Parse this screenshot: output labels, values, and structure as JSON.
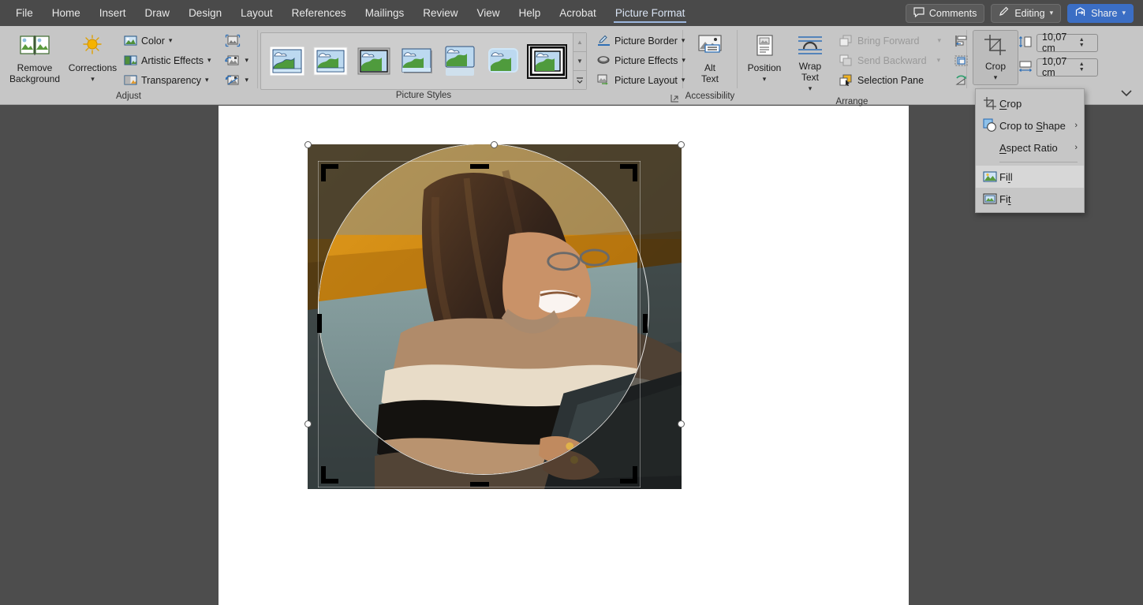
{
  "titlebar": {
    "menu": [
      {
        "label": "File",
        "active": false
      },
      {
        "label": "Home",
        "active": false
      },
      {
        "label": "Insert",
        "active": false
      },
      {
        "label": "Draw",
        "active": false
      },
      {
        "label": "Design",
        "active": false
      },
      {
        "label": "Layout",
        "active": false
      },
      {
        "label": "References",
        "active": false
      },
      {
        "label": "Mailings",
        "active": false
      },
      {
        "label": "Review",
        "active": false
      },
      {
        "label": "View",
        "active": false
      },
      {
        "label": "Help",
        "active": false
      },
      {
        "label": "Acrobat",
        "active": false
      },
      {
        "label": "Picture Format",
        "active": true
      }
    ],
    "comments_label": "Comments",
    "editing_label": "Editing",
    "share_label": "Share",
    "share_color": "#3b6ec4"
  },
  "ribbon": {
    "adjust": {
      "group_label": "Adjust",
      "remove_background": "Remove\nBackground",
      "remove_background_line1": "Remove",
      "remove_background_line2": "Background",
      "corrections": "Corrections",
      "color": "Color",
      "artistic_effects": "Artistic Effects",
      "transparency": "Transparency",
      "compress_icon": "compress-pictures-icon",
      "change_icon": "change-picture-icon",
      "reset_icon": "reset-picture-icon"
    },
    "picture_styles": {
      "group_label": "Picture Styles",
      "thumbnails": [
        {
          "name": "simple-frame-white",
          "selected": false
        },
        {
          "name": "beveled-matte-white",
          "selected": false
        },
        {
          "name": "metal-frame",
          "selected": false
        },
        {
          "name": "drop-shadow-rectangle",
          "selected": false
        },
        {
          "name": "reflected-rounded-rectangle",
          "selected": false
        },
        {
          "name": "soft-edge-rectangle",
          "selected": false
        },
        {
          "name": "double-frame-black",
          "selected": true
        }
      ],
      "scroll_up": "▲",
      "scroll_down": "▼",
      "more": "▼"
    },
    "picture_tools": {
      "picture_border": "Picture Border",
      "picture_effects": "Picture Effects",
      "picture_layout": "Picture Layout"
    },
    "accessibility": {
      "group_label": "Accessibility",
      "alt_text_line1": "Alt",
      "alt_text_line2": "Text"
    },
    "arrange": {
      "group_label": "Arrange",
      "position": "Position",
      "wrap_text_line1": "Wrap",
      "wrap_text_line2": "Text",
      "bring_forward": "Bring Forward",
      "send_backward": "Send Backward",
      "selection_pane": "Selection Pane",
      "align_icon": "align-objects-icon",
      "group_icon": "group-objects-icon",
      "rotate_icon": "rotate-objects-icon"
    },
    "size": {
      "crop_label": "Crop",
      "height_value": "10,07 cm",
      "width_value": "10,07 cm",
      "height_icon": "shape-height-icon",
      "width_icon": "shape-width-icon"
    },
    "collapse_icon": "collapse-ribbon-chevron-icon"
  },
  "crop_menu": {
    "items": [
      {
        "label": "Crop",
        "mnemonic": "C",
        "icon": "crop-icon",
        "submenu": false,
        "highlighted": false
      },
      {
        "label": "Crop to Shape",
        "mnemonic": "S",
        "icon": "crop-to-shape-icon",
        "submenu": true,
        "highlighted": false
      },
      {
        "label": "Aspect Ratio",
        "mnemonic": "A",
        "icon": "none",
        "submenu": true,
        "highlighted": false
      },
      {
        "label": "Fill",
        "mnemonic": "l",
        "icon": "fill-icon",
        "submenu": false,
        "highlighted": true
      },
      {
        "label": "Fit",
        "mnemonic": "t",
        "icon": "fit-icon",
        "submenu": false,
        "highlighted": false
      }
    ],
    "separator_after_index": 2
  },
  "document": {
    "page_background": "#ffffff",
    "workspace_background": "#4d4d4d",
    "picture": {
      "name": "woman-at-laptop-photo",
      "crop_shape": "oval",
      "description": "Woman with long curly hair wearing a striped cream, tan and black sweater, working at a laptop in front of an orange wall",
      "colors": {
        "wall": "#d08a16",
        "wall_shadow": "#a86a10",
        "desk": "#7e9496",
        "sweater_cream": "#e8dcc8",
        "sweater_tan": "#b08b6a",
        "sweater_black": "#14120f",
        "hair": "#3a271a",
        "laptop": "#2c3335"
      }
    }
  }
}
